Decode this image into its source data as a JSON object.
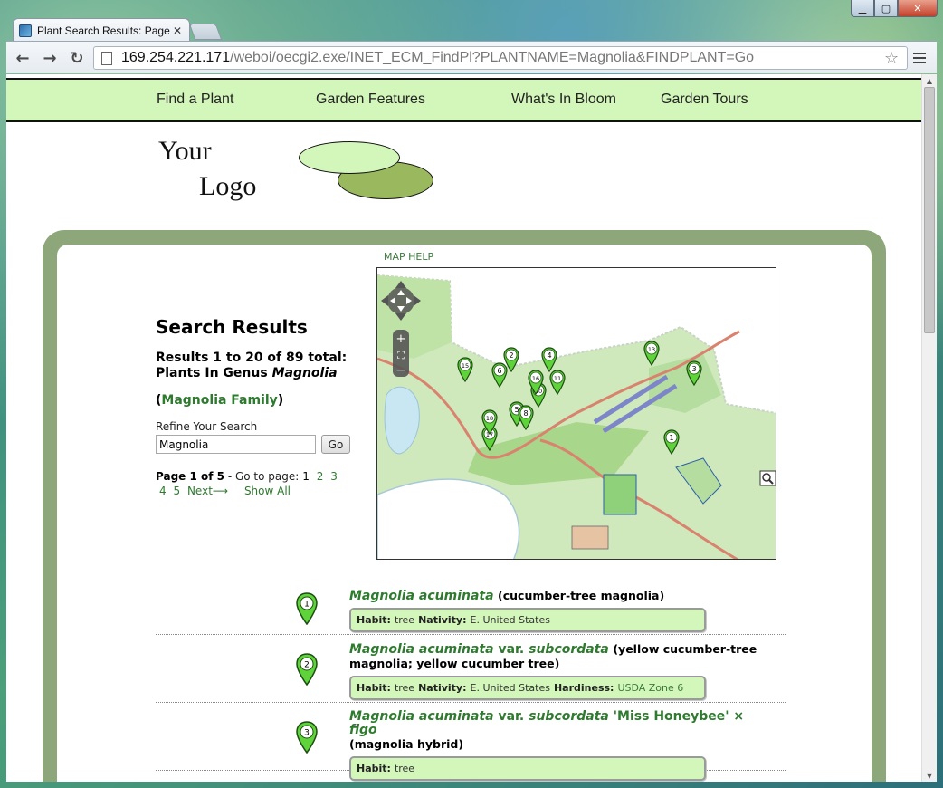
{
  "browser": {
    "tab_title": "Plant Search Results: Page",
    "url_host": "169.254.221.171",
    "url_path": "/weboi/oecgi2.exe/INET_ECM_FindPl?PLANTNAME=Magnolia&FINDPLANT=Go",
    "back_icon": "←",
    "forward_icon": "→",
    "reload_icon": "↻",
    "star_icon": "☆",
    "min_icon": "▁",
    "max_icon": "▢",
    "close_icon": "✕",
    "tab_close_icon": "✕"
  },
  "nav": {
    "items": [
      "Find a Plant",
      "Garden Features",
      "What's In Bloom",
      "Garden Tours"
    ]
  },
  "logo": {
    "line1": "Your",
    "line2": "Logo"
  },
  "map": {
    "help_label": "MAP HELP",
    "markers": [
      "1",
      "2",
      "3",
      "4",
      "5",
      "6",
      "8",
      "10",
      "11",
      "13",
      "15",
      "16",
      "17",
      "18"
    ]
  },
  "search": {
    "title": "Search Results",
    "count_text": "Results 1 to 20 of 89 total:",
    "genus_prefix": "Plants In Genus",
    "genus": "Magnolia",
    "family_open": "(",
    "family": "Magnolia Family",
    "family_close": ")",
    "refine_label": "Refine Your Search",
    "refine_value": "Magnolia",
    "go_label": "Go"
  },
  "pager": {
    "page_label": "Page 1 of 5",
    "goto_label": " - Go to page:",
    "current": "1",
    "pages": [
      "2",
      "3",
      "4",
      "5"
    ],
    "next_label": "Next⟶",
    "show_all": "Show All"
  },
  "results": [
    {
      "num": "1",
      "sci": "Magnolia acuminata",
      "common": "(cucumber-tree magnolia)",
      "habit_label": "Habit:",
      "habit": "tree",
      "nativity_label": "Nativity:",
      "nativity": "E. United States"
    },
    {
      "num": "2",
      "sci_a": "Magnolia acuminata",
      "sci_var": "var.",
      "sci_b": "subcordata",
      "common": "(yellow cucumber-tree magnolia; yellow cucumber tree)",
      "habit_label": "Habit:",
      "habit": "tree",
      "nativity_label": "Nativity:",
      "nativity": "E. United States",
      "hardiness_label": "Hardiness:",
      "hardiness": "USDA Zone 6"
    },
    {
      "num": "3",
      "sci_a": "Magnolia acuminata",
      "sci_var": "var.",
      "sci_b": "subcordata",
      "sci_c": "'Miss Honeybee' ×",
      "sci_d": "figo",
      "common": "(magnolia hybrid)",
      "habit_label": "Habit:",
      "habit": "tree"
    }
  ]
}
